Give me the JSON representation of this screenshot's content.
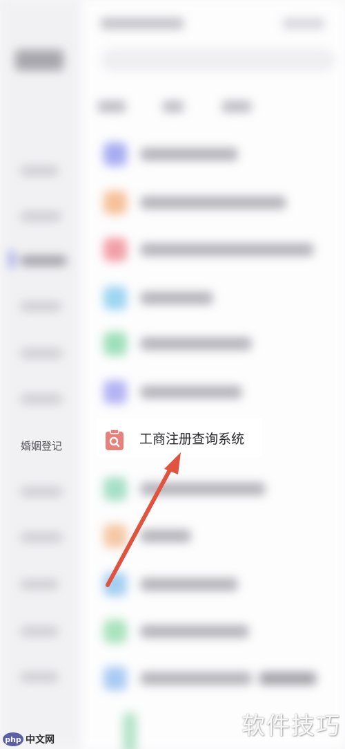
{
  "sidebar": {
    "selected_label": "婚姻登记"
  },
  "list": {
    "highlighted_item": {
      "label": "工商注册查询系统",
      "icon": "clipboard-search-icon"
    }
  },
  "watermark": {
    "text": "软件技巧",
    "site_logo": "php",
    "site_text": "中文网"
  },
  "colors": {
    "arrow": "#e0533f",
    "icon_red": "#e8817c"
  }
}
